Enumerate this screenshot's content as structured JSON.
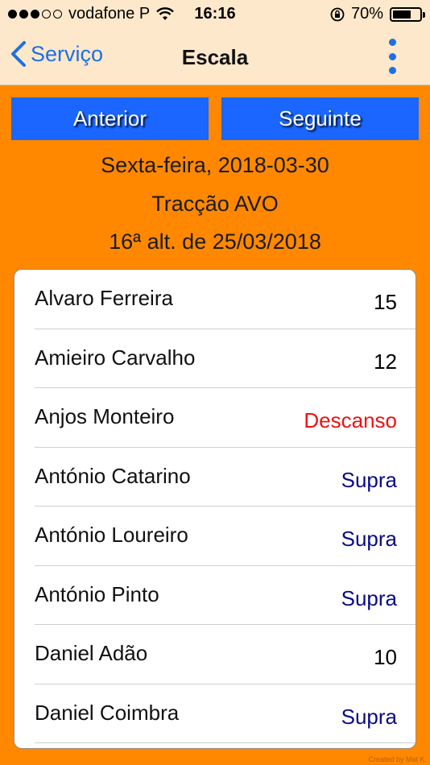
{
  "status_bar": {
    "carrier": "vodafone P",
    "time": "16:16",
    "battery": "70%",
    "battery_level": 0.7
  },
  "nav": {
    "back_label": "Serviço",
    "title": "Escala",
    "more_icon": "vertical-ellipsis-icon"
  },
  "buttons": {
    "prev_label": "Anterior",
    "next_label": "Seguinte"
  },
  "info": {
    "date": "Sexta-feira, 2018-03-30",
    "traction": "Tracção AVO",
    "alteration": "16ª alt. de 25/03/2018"
  },
  "rows": [
    {
      "name": "Alvaro Ferreira",
      "value": "15"
    },
    {
      "name": "Amieiro Carvalho",
      "value": "12"
    },
    {
      "name": "Anjos Monteiro",
      "value": "Descanso"
    },
    {
      "name": "António Catarino",
      "value": "Supra"
    },
    {
      "name": "António Loureiro",
      "value": "Supra"
    },
    {
      "name": "António Pinto",
      "value": "Supra"
    },
    {
      "name": "Daniel Adão",
      "value": "10"
    },
    {
      "name": "Daniel Coimbra",
      "value": "Supra"
    }
  ],
  "colors": {
    "background": "#ff8800",
    "header": "#fde8cc",
    "accent": "#1f6fe0",
    "button": "#1a66ff",
    "rest": "#ee1111",
    "supra": "#0a0a88"
  },
  "watermark": "Created by Mat K."
}
